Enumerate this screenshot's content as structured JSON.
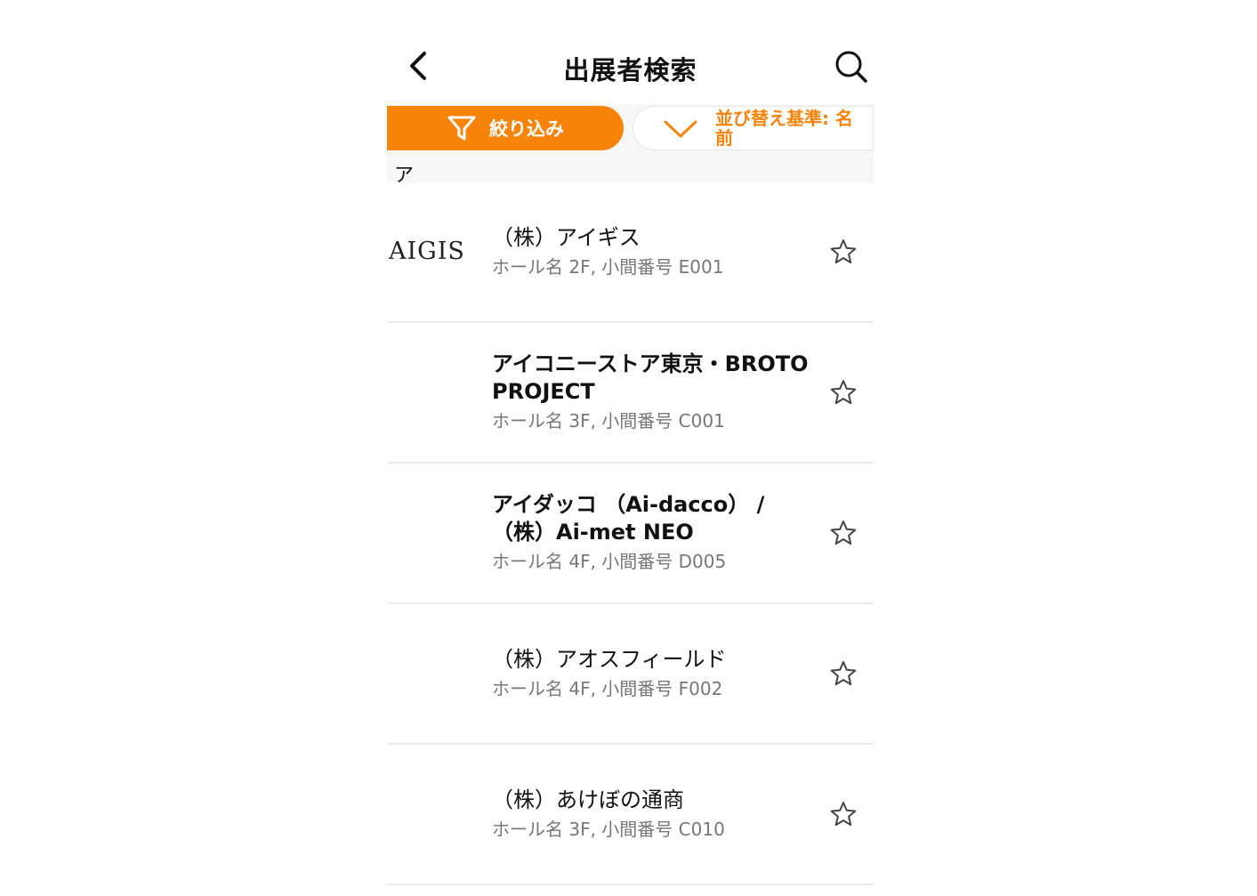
{
  "header": {
    "title": "出展者検索"
  },
  "toolbar": {
    "filter_label": "絞り込み",
    "sort_label": "並び替え基準: 名前"
  },
  "section": {
    "label": "ア"
  },
  "exhibitors": [
    {
      "logo_text": "AIGIS",
      "name": "（株）アイギス",
      "location": "ホール名 2F, 小間番号 E001"
    },
    {
      "logo_text": "",
      "name": "アイコニーストア東京・BROTO PROJECT",
      "location": "ホール名 3F, 小間番号 C001"
    },
    {
      "logo_text": "",
      "name": "アイダッコ （Ai-dacco） / （株）Ai-met NEO",
      "location": "ホール名 4F, 小間番号 D005"
    },
    {
      "logo_text": "",
      "name": "（株）アオスフィールド",
      "location": "ホール名 4F, 小間番号 F002"
    },
    {
      "logo_text": "",
      "name": "（株）あけぼの通商",
      "location": "ホール名 3F, 小間番号 C010"
    }
  ],
  "colors": {
    "accent": "#f6840b",
    "subtext": "#777777",
    "divider": "#ececec"
  },
  "icons": {
    "back": "chevron-left-icon",
    "search": "search-icon",
    "filter": "funnel-icon",
    "sort": "chevron-down-icon",
    "favorite": "star-outline-icon"
  }
}
